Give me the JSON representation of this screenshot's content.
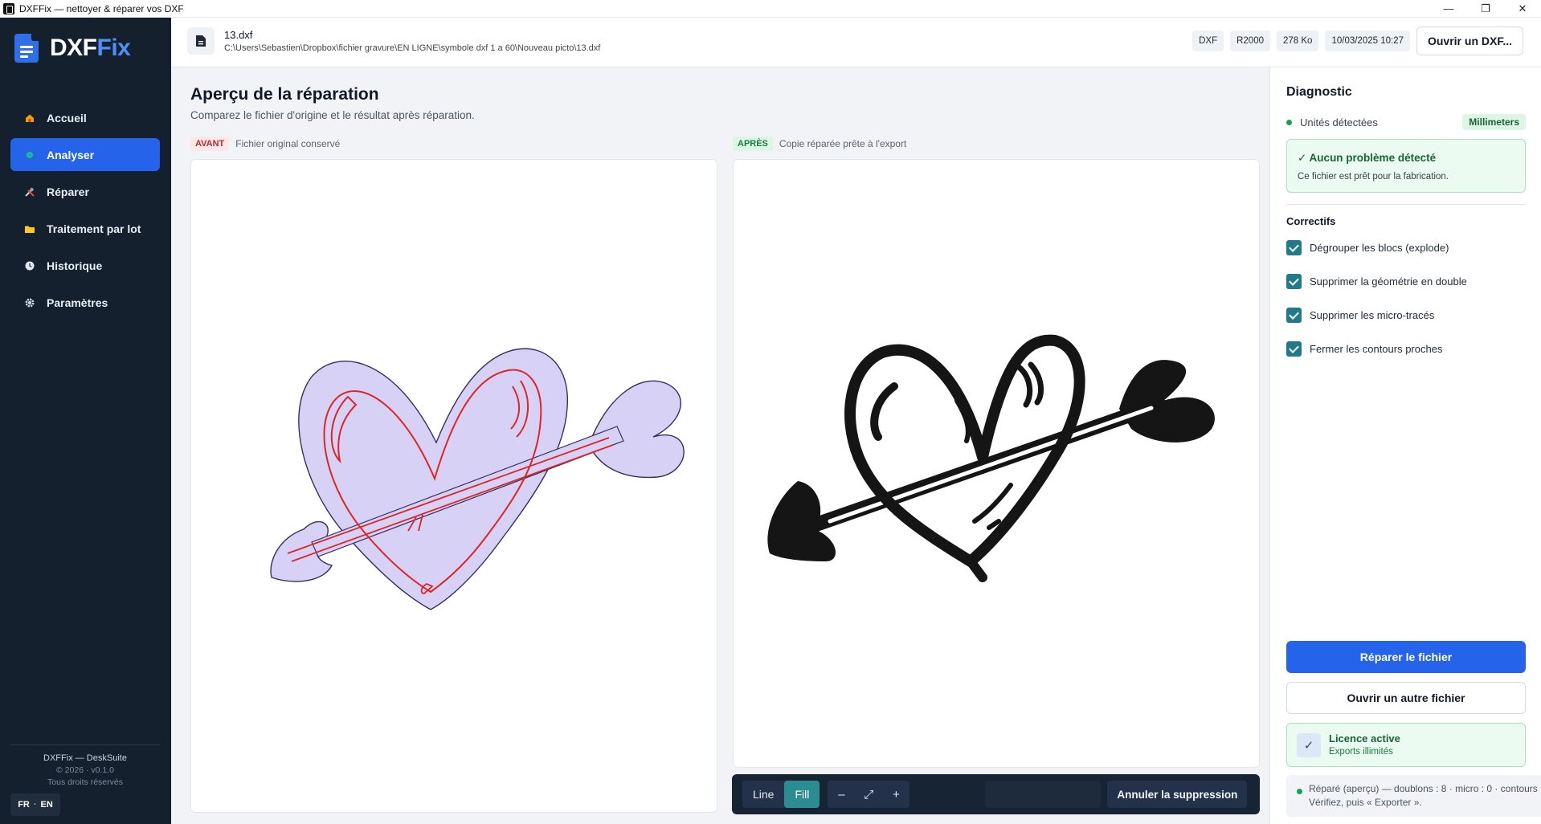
{
  "window": {
    "title": "DXFFix — nettoyer & réparer vos DXF",
    "controls": {
      "minimize": "—",
      "maximize": "❐",
      "close": "✕"
    }
  },
  "brand": {
    "name_a": "DXF",
    "name_b": "Fix",
    "accent": "#4f8ff7"
  },
  "sidebar": {
    "items": [
      {
        "label": "Accueil",
        "icon": "home-icon"
      },
      {
        "label": "Analyser",
        "icon": "analyze-icon",
        "active": true
      },
      {
        "label": "Réparer",
        "icon": "tools-icon"
      },
      {
        "label": "Traitement par lot",
        "icon": "folder-icon"
      },
      {
        "label": "Historique",
        "icon": "clock-icon"
      },
      {
        "label": "Paramètres",
        "icon": "gear-icon"
      }
    ],
    "footer": {
      "product": "DXFFix — DeskSuite",
      "version": "© 2026 · v0.1.0",
      "rights": "Tous droits réservés"
    },
    "lang": {
      "fr": "FR",
      "sep": "·",
      "en": "EN"
    }
  },
  "header": {
    "file_name": "13.dxf",
    "file_path": "C:\\Users\\Sebastien\\Dropbox\\fichier gravure\\EN LIGNE\\symbole dxf 1 a 60\\Nouveau picto\\13.dxf",
    "tags": [
      "DXF",
      "R2000",
      "278 Ko",
      "10/03/2025 10:27"
    ],
    "open_button": "Ouvrir un DXF..."
  },
  "main": {
    "title": "Aperçu de la réparation",
    "subtitle": "Comparez le fichier d'origine et le résultat après réparation.",
    "before": {
      "pill": "AVANT",
      "caption": "Fichier original conservé"
    },
    "after": {
      "pill": "APRÈS",
      "caption": "Copie réparée prête à l'export"
    },
    "toolbar": {
      "line": "Line",
      "fill": "Fill",
      "zoom_out": "–",
      "fit": "⤢",
      "zoom_in": "+",
      "undo": "Annuler la suppression"
    }
  },
  "diagnostic": {
    "title": "Diagnostic",
    "units_label": "Unités détectées",
    "units_value": "Millimeters",
    "ok_title": "✓ Aucun problème détecté",
    "ok_sub": "Ce fichier est prêt pour la fabrication.",
    "fixes_title": "Correctifs",
    "fixes": [
      "Dégrouper les blocs (explode)",
      "Supprimer la géométrie en double",
      "Supprimer les micro-tracés",
      "Fermer les contours proches"
    ],
    "repair_button": "Réparer le fichier",
    "open_other_button": "Ouvrir un autre fichier",
    "license_title": "Licence active",
    "license_sub": "Exports illimités",
    "status_line1": "Réparé (aperçu) — doublons : 8 · micro : 0 · contours",
    "status_line2": "Vérifiez, puis « Exporter »."
  }
}
